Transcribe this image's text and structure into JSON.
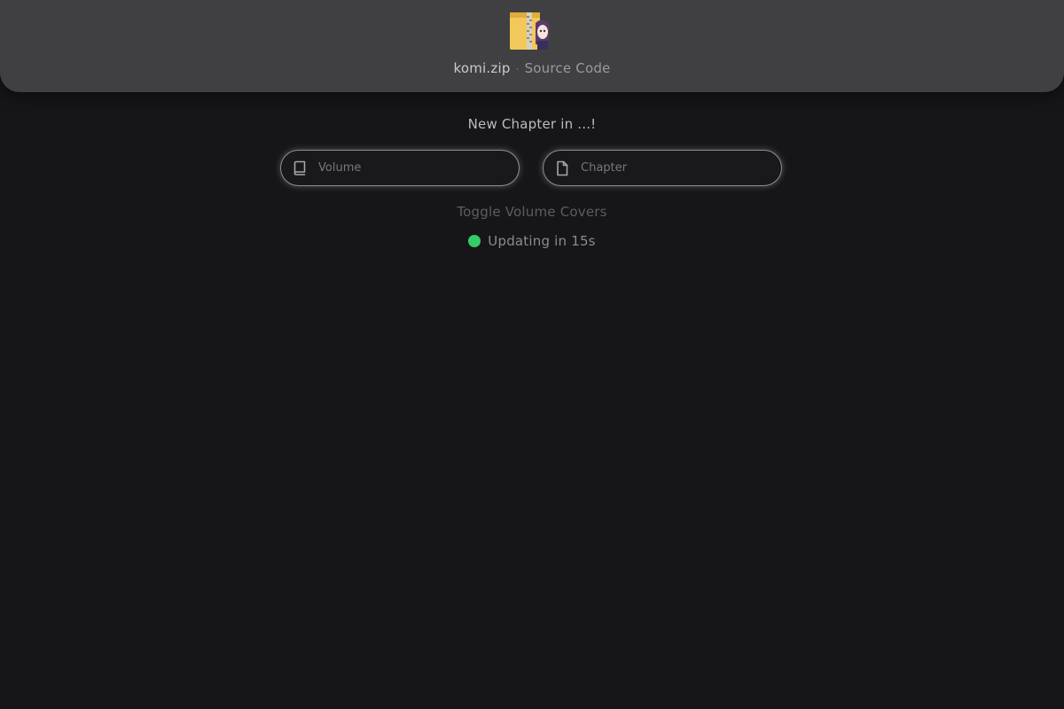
{
  "header": {
    "brand": "komi.zip",
    "separator": "·",
    "source_link": "Source Code",
    "logo_icon": "zip-folder-character-logo-icon"
  },
  "main": {
    "headline": "New Chapter in ...!",
    "volume_field": {
      "placeholder": "Volume",
      "value": "",
      "icon": "book-icon"
    },
    "chapter_field": {
      "placeholder": "Chapter",
      "value": "",
      "icon": "file-icon"
    },
    "toggle_label": "Toggle Volume Covers",
    "status": {
      "text": "Updating in 15s",
      "dot_color": "#33cc66"
    }
  },
  "colors": {
    "background": "#161618",
    "header": "#404042",
    "status_green": "#33cc66"
  }
}
